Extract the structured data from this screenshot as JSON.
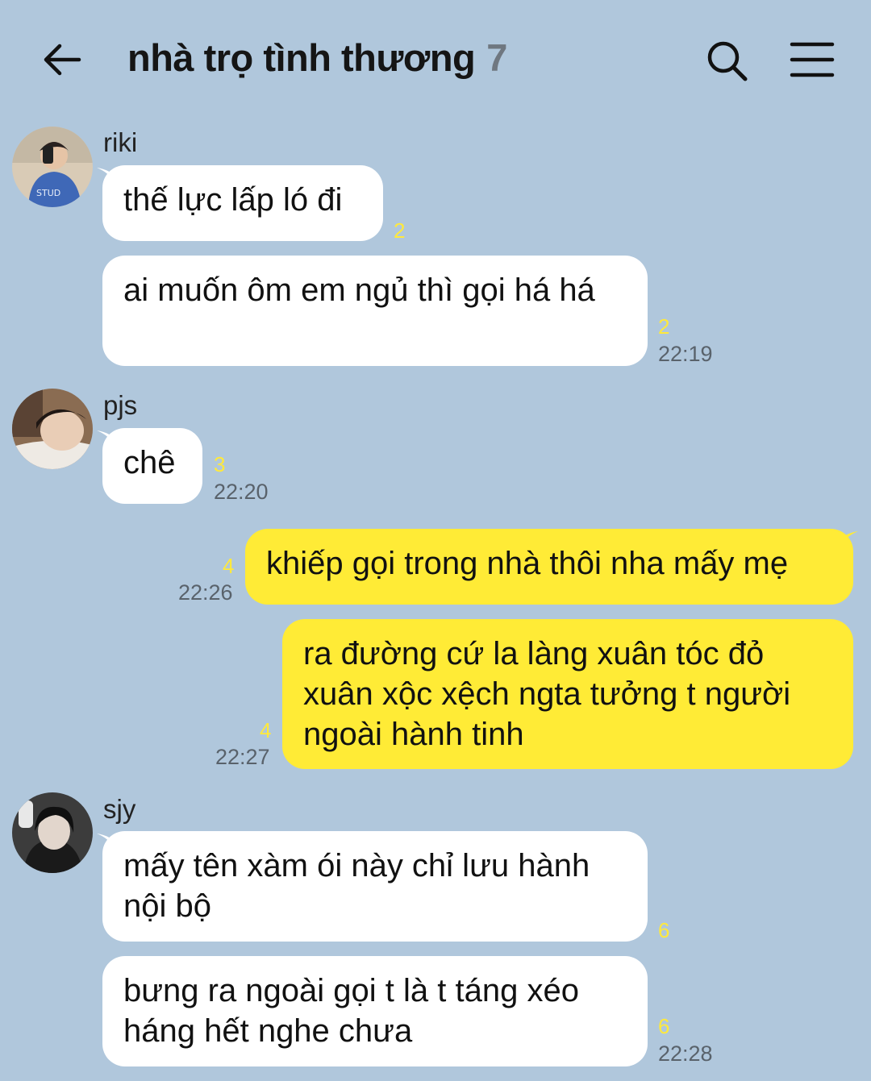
{
  "header": {
    "title": "nhà trọ tình thương",
    "member_count": "7",
    "icons": {
      "back": "arrow-left-icon",
      "search": "search-icon",
      "menu": "hamburger-menu-icon"
    }
  },
  "colors": {
    "background": "#b0c7dc",
    "incoming_bubble": "#ffffff",
    "outgoing_bubble": "#ffeb36",
    "unread_count": "#ffe93c"
  },
  "groups": [
    {
      "sender": "riki",
      "messages": [
        {
          "text": "thế lực lấp ló đi",
          "unread": "2",
          "time": ""
        },
        {
          "text": "ai muốn ôm em ngủ thì gọi há há",
          "unread": "2",
          "time": "22:19"
        }
      ]
    },
    {
      "sender": "pjs",
      "messages": [
        {
          "text": "chê",
          "unread": "3",
          "time": "22:20"
        }
      ]
    },
    {
      "sender": "me",
      "messages": [
        {
          "text": "khiếp gọi trong nhà thôi nha mấy mẹ",
          "unread": "4",
          "time": "22:26"
        },
        {
          "text": "ra đường cứ la làng xuân tóc đỏ xuân xộc xệch ngta tưởng t người ngoài hành tinh",
          "unread": "4",
          "time": "22:27"
        }
      ]
    },
    {
      "sender": "sjy",
      "messages": [
        {
          "text": "mấy tên xàm ói này chỉ lưu hành nội bộ",
          "unread": "6",
          "time": ""
        },
        {
          "text": "bưng ra ngoài gọi t là t táng xéo háng hết nghe chưa",
          "unread": "6",
          "time": "22:28"
        }
      ]
    }
  ]
}
